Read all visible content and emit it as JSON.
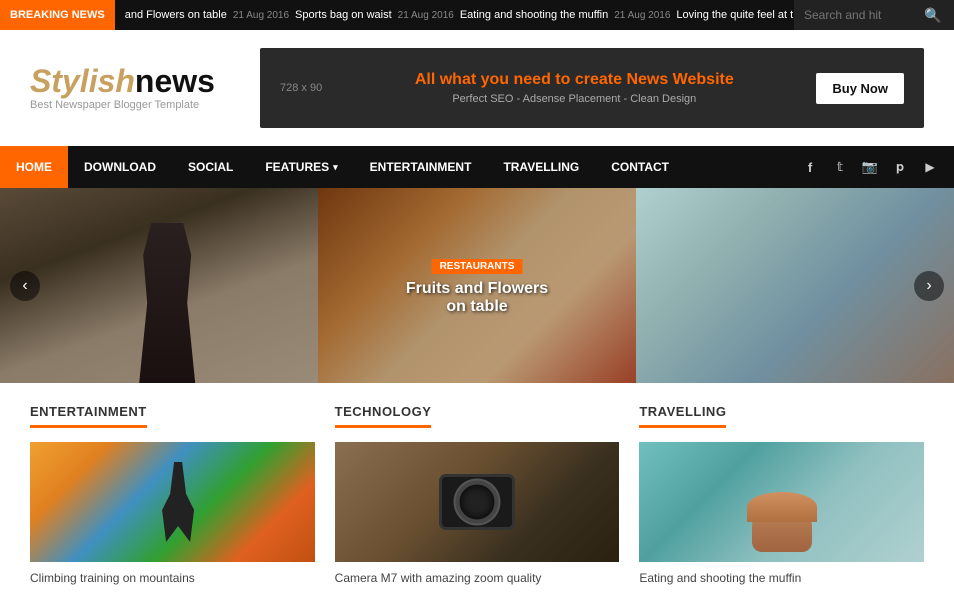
{
  "breaking_news": {
    "label": "BREAKING NEWS",
    "items": [
      {
        "date": "21 Aug 2016",
        "title": "and Flowers on table"
      },
      {
        "date": "21 Aug 2016",
        "title": "Sports bag on waist"
      },
      {
        "date": "21 Aug 2016",
        "title": "Eating and shooting the muffin"
      },
      {
        "date": "21 Aug 2016",
        "title": "Loving the quite feel at this"
      }
    ],
    "search_placeholder": "Search and hit"
  },
  "header": {
    "logo_light": "Stylish",
    "logo_bold": "news",
    "logo_sub": "Best Newspaper Blogger Template",
    "ad_size": "728 x 90",
    "ad_headline_pre": "All what you need to create ",
    "ad_brand": "News",
    "ad_headline_post": " Website",
    "ad_sub": "Perfect SEO - Adsense Placement - Clean Design",
    "ad_button": "Buy Now"
  },
  "nav": {
    "items": [
      {
        "label": "HOME",
        "active": true,
        "has_dropdown": false
      },
      {
        "label": "DOWNLOAD",
        "active": false,
        "has_dropdown": false
      },
      {
        "label": "SOCIAL",
        "active": false,
        "has_dropdown": false
      },
      {
        "label": "FEATURES",
        "active": false,
        "has_dropdown": true
      },
      {
        "label": "ENTERTAINMENT",
        "active": false,
        "has_dropdown": false
      },
      {
        "label": "TRAVELLING",
        "active": false,
        "has_dropdown": false
      },
      {
        "label": "CONTACT",
        "active": false,
        "has_dropdown": false
      }
    ],
    "social": [
      {
        "name": "facebook-icon",
        "symbol": "f"
      },
      {
        "name": "twitter-icon",
        "symbol": "t"
      },
      {
        "name": "instagram-icon",
        "symbol": "in"
      },
      {
        "name": "pinterest-icon",
        "symbol": "p"
      },
      {
        "name": "youtube-icon",
        "symbol": "▶"
      }
    ]
  },
  "slider": {
    "prev_label": "‹",
    "next_label": "›",
    "slides": [
      {
        "type": "left",
        "category": "",
        "title": ""
      },
      {
        "type": "center",
        "category": "RESTAURANTS",
        "title": "Fruits and Flowers on table"
      },
      {
        "type": "right",
        "category": "",
        "title": ""
      }
    ]
  },
  "sections": [
    {
      "title": "ENTERTAINMENT",
      "img_type": "climbing",
      "caption": "Climbing training on mountains"
    },
    {
      "title": "TECHNOLOGY",
      "img_type": "camera",
      "caption": "Camera M7 with amazing zoom quality"
    },
    {
      "title": "TRAVELLING",
      "img_type": "muffin",
      "caption": "Eating and shooting the muffin"
    }
  ]
}
